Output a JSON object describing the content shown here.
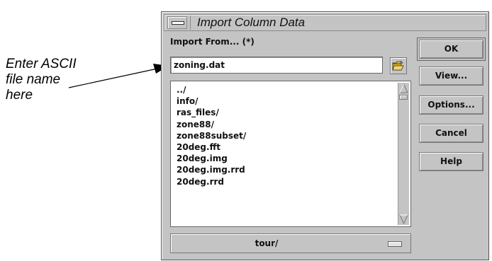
{
  "annotation": {
    "lines": [
      "Enter ASCII",
      "file name",
      "here"
    ]
  },
  "dialog": {
    "title": "Import Column Data",
    "import_label": "Import From... (*)",
    "filename_value": "zoning.dat",
    "file_list": [
      "../",
      "info/",
      "ras_files/",
      "zone88/",
      "zone88subset/",
      "20deg.fft",
      "20deg.img",
      "20deg.img.rrd",
      "20deg.rrd"
    ],
    "directory": "tour/",
    "buttons": {
      "ok": "OK",
      "view": "View...",
      "options": "Options...",
      "cancel": "Cancel",
      "help": "Help"
    }
  },
  "icons": {
    "window_menu": "window-menu-icon",
    "folder": "open-folder-icon",
    "scroll_up": "scroll-up-arrow-icon",
    "scroll_down": "scroll-down-arrow-icon"
  },
  "colors": {
    "dialog_bg": "#c4c4c4",
    "folder_yellow": "#e8c440"
  }
}
